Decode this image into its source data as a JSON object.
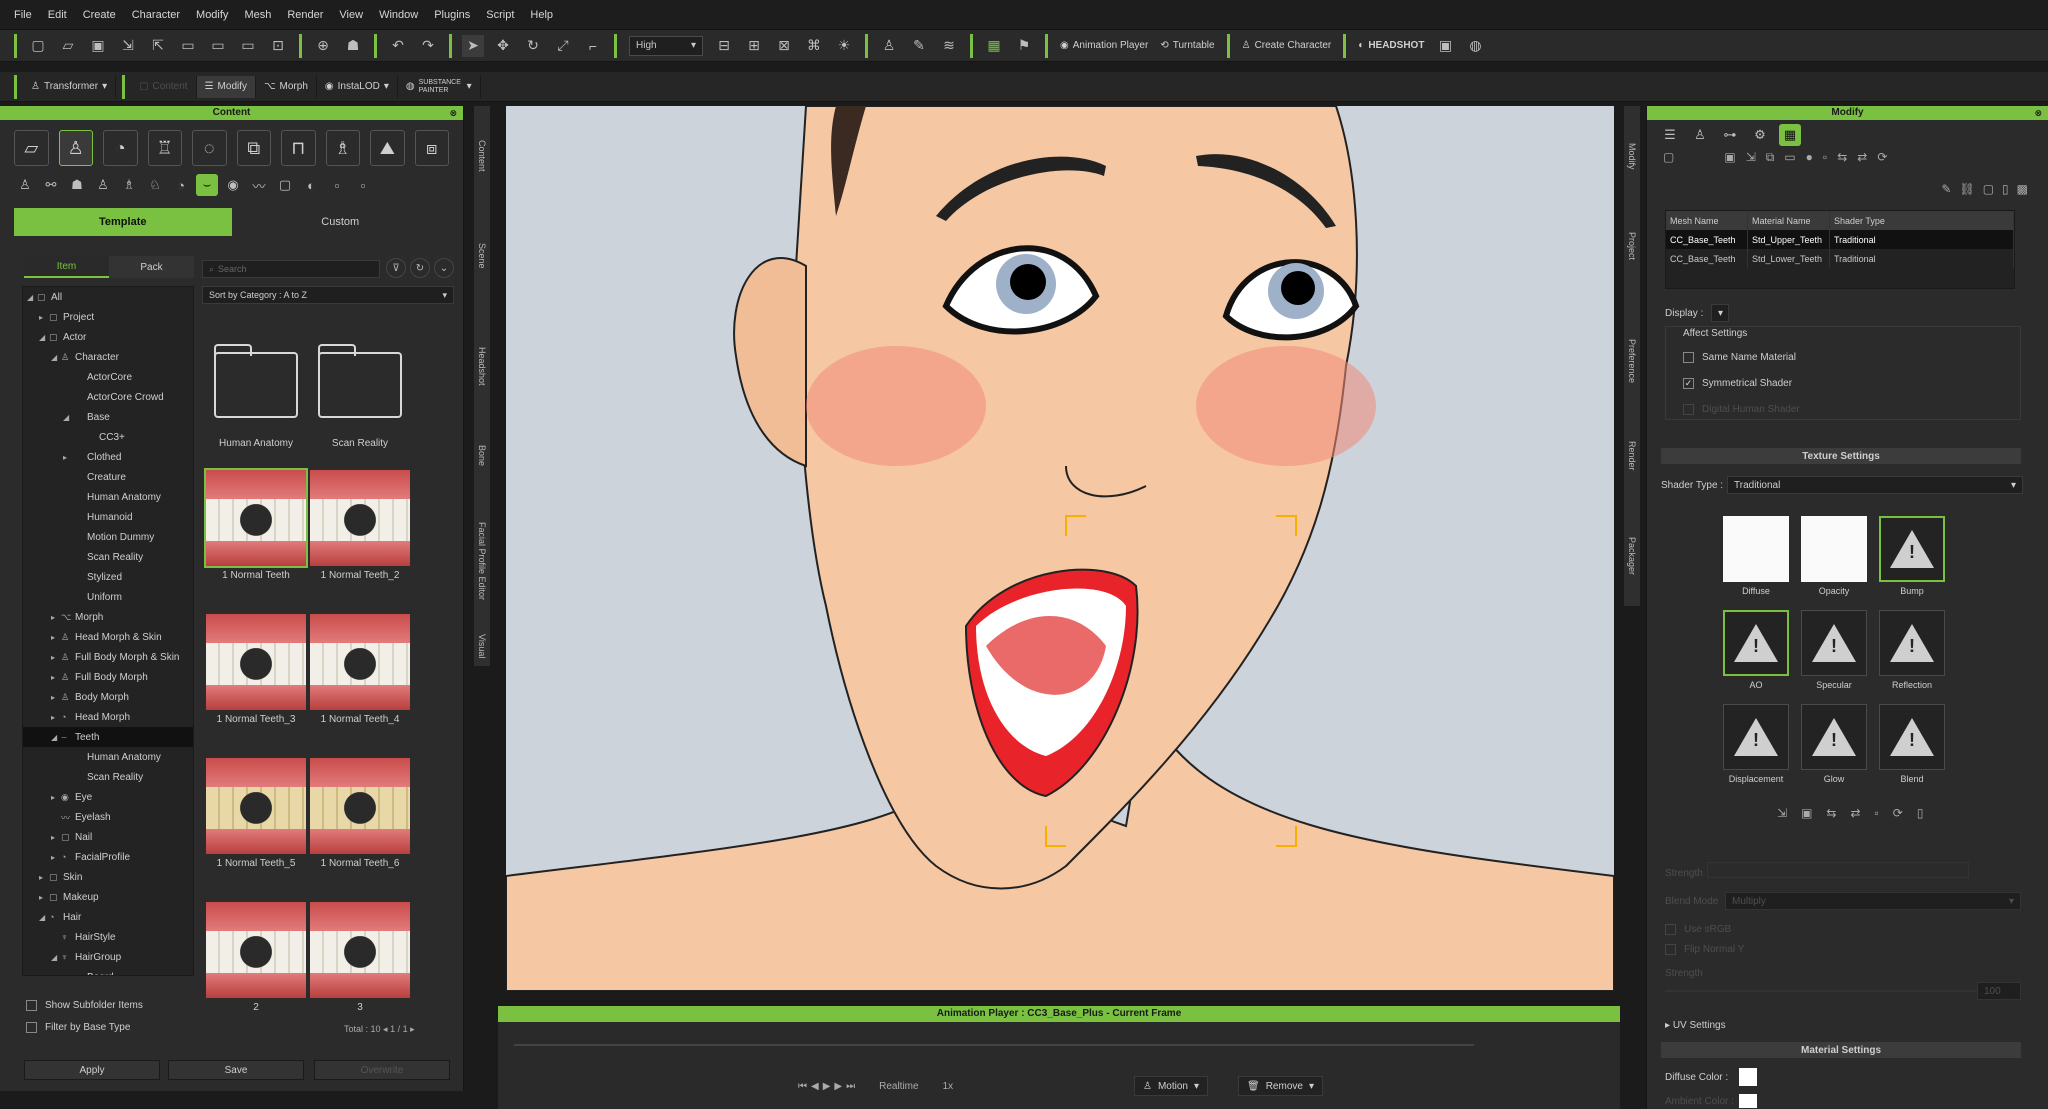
{
  "menu": [
    "File",
    "Edit",
    "Create",
    "Character",
    "Modify",
    "Mesh",
    "Render",
    "View",
    "Window",
    "Plugins",
    "Script",
    "Help"
  ],
  "toolbar": {
    "quality": "High",
    "animation_player": "Animation Player",
    "turntable": "Turntable",
    "create_character": "Create Character",
    "headshot": "HEADSHOT"
  },
  "toolbar2": {
    "transformer": "Transformer",
    "content": "Content",
    "modify": "Modify",
    "morph": "Morph",
    "instalod": "InstaLOD",
    "substance": "SUBSTANCE PAINTER"
  },
  "content": {
    "title": "Content",
    "tabs": [
      "Template",
      "Custom"
    ],
    "subtabs": [
      "Item",
      "Pack"
    ],
    "search_placeholder": "Search",
    "sort": "Sort by Category : A to Z",
    "tree": [
      {
        "label": "All",
        "indent": 0,
        "arrow": "◢",
        "icon": "▢"
      },
      {
        "label": "Project",
        "indent": 1,
        "arrow": "▸",
        "icon": "▢"
      },
      {
        "label": "Actor",
        "indent": 1,
        "arrow": "◢",
        "icon": "▢"
      },
      {
        "label": "Character",
        "indent": 2,
        "arrow": "◢",
        "icon": "♙"
      },
      {
        "label": "ActorCore",
        "indent": 3,
        "arrow": "",
        "icon": ""
      },
      {
        "label": "ActorCore Crowd",
        "indent": 3,
        "arrow": "",
        "icon": ""
      },
      {
        "label": "Base",
        "indent": 3,
        "arrow": "◢",
        "icon": ""
      },
      {
        "label": "CC3+",
        "indent": 4,
        "arrow": "",
        "icon": ""
      },
      {
        "label": "Clothed",
        "indent": 3,
        "arrow": "▸",
        "icon": ""
      },
      {
        "label": "Creature",
        "indent": 3,
        "arrow": "",
        "icon": ""
      },
      {
        "label": "Human Anatomy",
        "indent": 3,
        "arrow": "",
        "icon": ""
      },
      {
        "label": "Humanoid",
        "indent": 3,
        "arrow": "",
        "icon": ""
      },
      {
        "label": "Motion Dummy",
        "indent": 3,
        "arrow": "",
        "icon": ""
      },
      {
        "label": "Scan Reality",
        "indent": 3,
        "arrow": "",
        "icon": ""
      },
      {
        "label": "Stylized",
        "indent": 3,
        "arrow": "",
        "icon": ""
      },
      {
        "label": "Uniform",
        "indent": 3,
        "arrow": "",
        "icon": ""
      },
      {
        "label": "Morph",
        "indent": 2,
        "arrow": "▸",
        "icon": "⌥"
      },
      {
        "label": "Head Morph & Skin",
        "indent": 2,
        "arrow": "▸",
        "icon": "♙"
      },
      {
        "label": "Full Body Morph & Skin",
        "indent": 2,
        "arrow": "▸",
        "icon": "♙"
      },
      {
        "label": "Full Body Morph",
        "indent": 2,
        "arrow": "▸",
        "icon": "♙"
      },
      {
        "label": "Body Morph",
        "indent": 2,
        "arrow": "▸",
        "icon": "♙"
      },
      {
        "label": "Head Morph",
        "indent": 2,
        "arrow": "▸",
        "icon": "◔"
      },
      {
        "label": "Teeth",
        "indent": 2,
        "arrow": "◢",
        "icon": "⌣",
        "sel": true
      },
      {
        "label": "Human Anatomy",
        "indent": 3,
        "arrow": "",
        "icon": ""
      },
      {
        "label": "Scan Reality",
        "indent": 3,
        "arrow": "",
        "icon": ""
      },
      {
        "label": "Eye",
        "indent": 2,
        "arrow": "▸",
        "icon": "◉"
      },
      {
        "label": "Eyelash",
        "indent": 2,
        "arrow": "",
        "icon": "〰"
      },
      {
        "label": "Nail",
        "indent": 2,
        "arrow": "▸",
        "icon": "▢"
      },
      {
        "label": "FacialProfile",
        "indent": 2,
        "arrow": "▸",
        "icon": "◔"
      },
      {
        "label": "Skin",
        "indent": 1,
        "arrow": "▸",
        "icon": "▢"
      },
      {
        "label": "Makeup",
        "indent": 1,
        "arrow": "▸",
        "icon": "▢"
      },
      {
        "label": "Hair",
        "indent": 1,
        "arrow": "◢",
        "icon": "◔"
      },
      {
        "label": "HairStyle",
        "indent": 2,
        "arrow": "",
        "icon": "♆"
      },
      {
        "label": "HairGroup",
        "indent": 2,
        "arrow": "◢",
        "icon": "♆"
      },
      {
        "label": "Beard",
        "indent": 3,
        "arrow": "▸",
        "icon": ""
      }
    ],
    "items": [
      {
        "label": "Human Anatomy",
        "kind": "folder"
      },
      {
        "label": "Scan Reality",
        "kind": "folder"
      },
      {
        "label": "1 Normal Teeth",
        "kind": "teeth",
        "sel": true
      },
      {
        "label": "1 Normal Teeth_2",
        "kind": "teeth"
      },
      {
        "label": "1 Normal Teeth_3",
        "kind": "teeth"
      },
      {
        "label": "1 Normal Teeth_4",
        "kind": "teeth"
      },
      {
        "label": "1 Normal Teeth_5",
        "kind": "yellow"
      },
      {
        "label": "1 Normal Teeth_6",
        "kind": "yellow"
      },
      {
        "label": "2",
        "kind": "teeth"
      },
      {
        "label": "3",
        "kind": "teeth"
      }
    ],
    "show_subfolder": "Show Subfolder Items",
    "filter_base": "Filter by Base Type",
    "total": "Total : 10",
    "page": "1 / 1",
    "apply": "Apply",
    "save": "Save",
    "overwrite": "Overwrite"
  },
  "side_tabs_left": [
    "Content",
    "Scene",
    "Headshot",
    "Bone",
    "Facial Profile Editor",
    "Visual"
  ],
  "side_tabs_right": [
    "Modify",
    "Project",
    "Preference",
    "Render",
    "Packager"
  ],
  "anim": {
    "title": "Animation Player : CC3_Base_Plus - Current Frame",
    "realtime": "Realtime",
    "speed": "1x",
    "motion": "Motion",
    "remove": "Remove"
  },
  "modify": {
    "title": "Modify",
    "table_headers": [
      "Mesh Name",
      "Material Name",
      "Shader Type"
    ],
    "rows": [
      [
        "CC_Base_Teeth",
        "Std_Upper_Teeth",
        "Traditional"
      ],
      [
        "CC_Base_Teeth",
        "Std_Lower_Teeth",
        "Traditional"
      ]
    ],
    "display_label": "Display :",
    "affect_settings": "Affect Settings",
    "same_name_material": "Same Name Material",
    "symmetrical_shader": "Symmetrical Shader",
    "digital_human_shader": "Digital Human Shader",
    "texture_settings": "Texture Settings",
    "shader_type_label": "Shader Type :",
    "shader_type_value": "Traditional",
    "slots": [
      "Diffuse",
      "Opacity",
      "Bump",
      "AO",
      "Specular",
      "Reflection",
      "Displacement",
      "Glow",
      "Blend"
    ],
    "strength_label": "Strength",
    "blend_mode_label": "Blend Mode",
    "blend_mode_value": "Multiply",
    "use_srgb": "Use sRGB",
    "flip_normal_y": "Flip Normal Y",
    "uv_settings": "UV Settings",
    "material_settings": "Material Settings",
    "diffuse_color": "Diffuse Color :",
    "ambient_color": "Ambient Color :",
    "strength_value": "100"
  },
  "colors": {
    "accent": "#7ac142",
    "skin": "#f5c7a2",
    "lips": "#e8242a",
    "bg": "#cdd3da"
  }
}
